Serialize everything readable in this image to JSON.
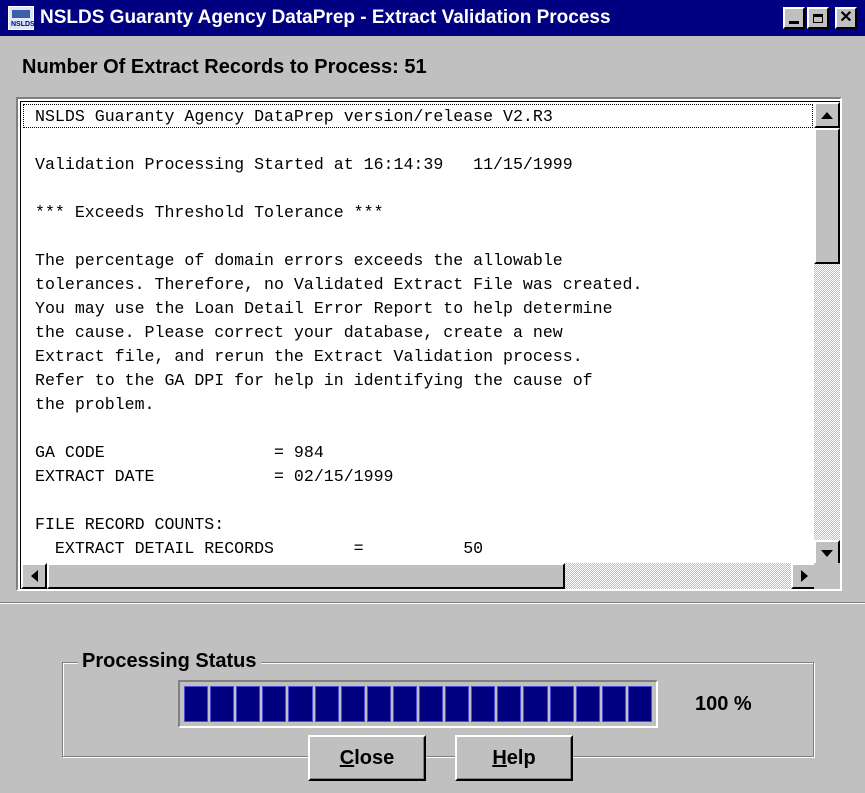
{
  "window": {
    "title": "NSLDS Guaranty Agency DataPrep - Extract Validation Process",
    "icon_name": "nslds-app-icon",
    "icon_label": "NSLDS"
  },
  "record_count_label": "Number Of Extract Records to Process: 51",
  "log": {
    "lines": [
      "NSLDS Guaranty Agency DataPrep version/release V2.R3",
      "",
      "Validation Processing Started at 16:14:39   11/15/1999",
      "",
      "*** Exceeds Threshold Tolerance ***",
      "",
      "The percentage of domain errors exceeds the allowable",
      "tolerances. Therefore, no Validated Extract File was created.",
      "You may use the Loan Detail Error Report to help determine",
      "the cause. Please correct your database, create a new",
      "Extract file, and rerun the Extract Validation process.",
      "Refer to the GA DPI for help in identifying the cause of",
      "the problem.",
      "",
      "GA CODE                 = 984",
      "EXTRACT DATE            = 02/15/1999",
      "",
      "FILE RECORD COUNTS:",
      "  EXTRACT DETAIL RECORDS        =          50"
    ],
    "vertical_scroll_fraction": 0.0,
    "horizontal_scroll_fraction": 0.0
  },
  "status": {
    "group_label": "Processing Status",
    "progress_fraction": 1.0,
    "segment_count": 18,
    "percent_label": "100  %"
  },
  "buttons": {
    "close_accel": "C",
    "close_rest": "lose",
    "help_accel": "H",
    "help_rest": "elp"
  },
  "colors": {
    "titlebar": "#000080",
    "face": "#c0c0c0",
    "progress_fill": "#000080"
  }
}
